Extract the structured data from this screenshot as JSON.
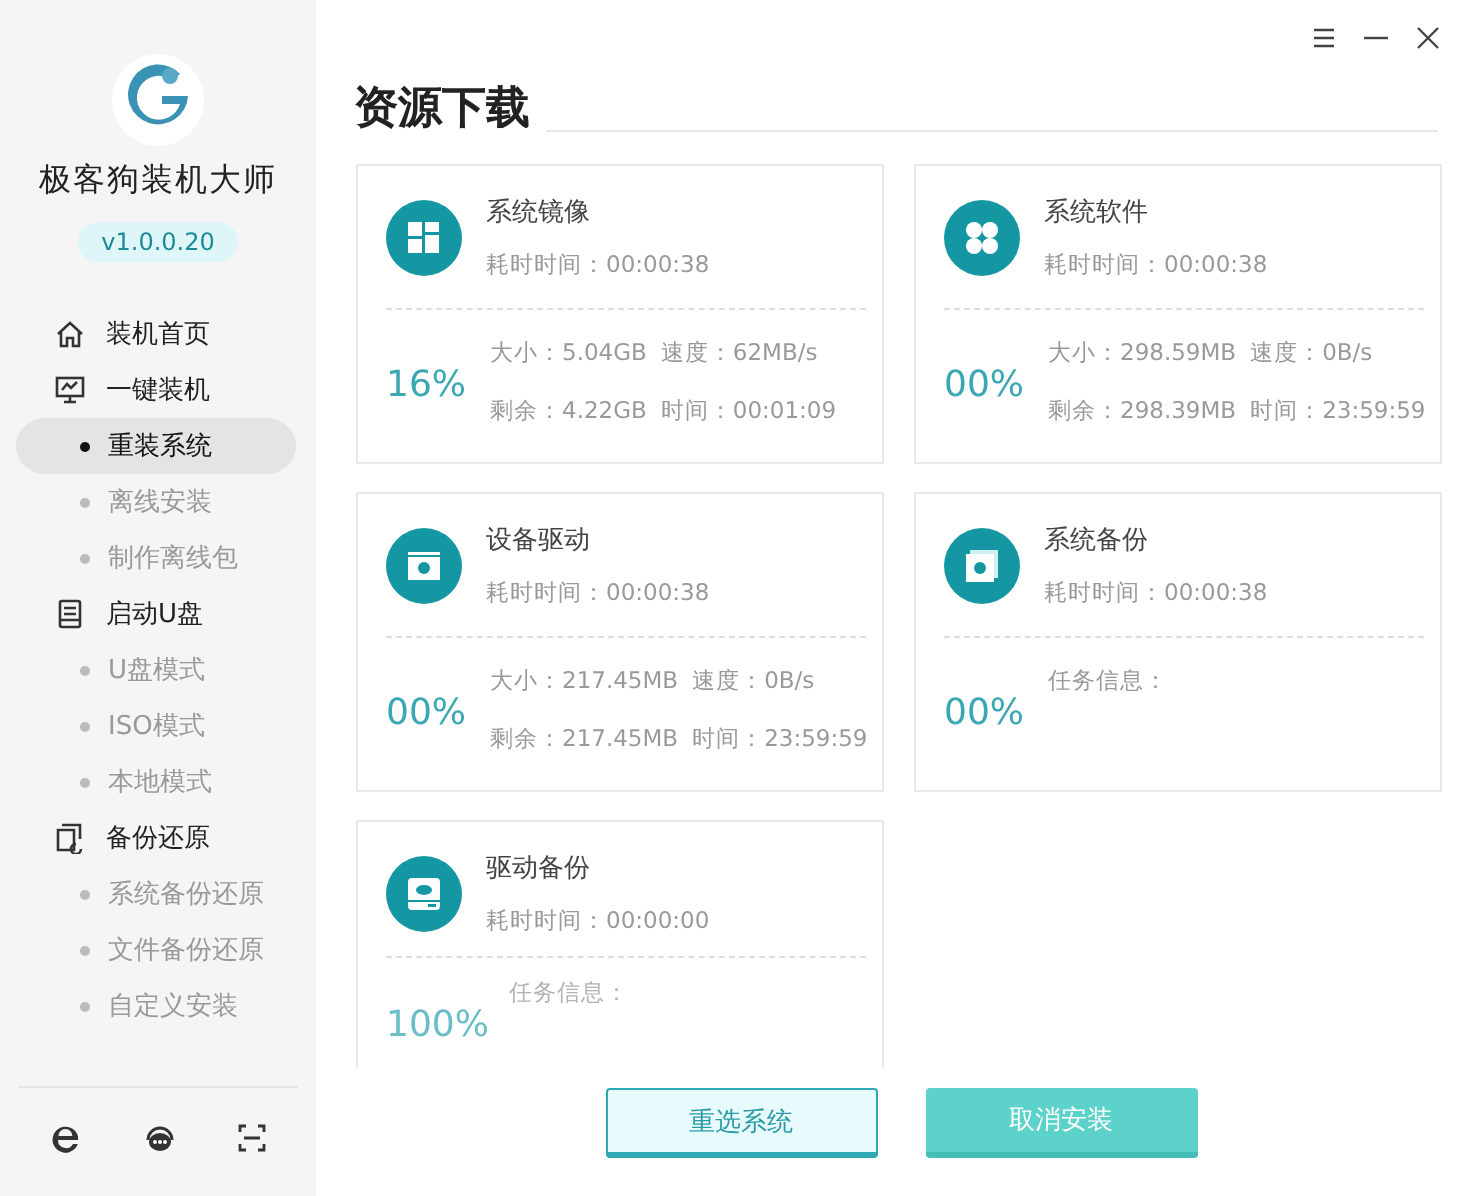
{
  "app": {
    "name": "极客狗装机大师",
    "version": "v1.0.0.20"
  },
  "sidebar": {
    "groups": [
      {
        "label": "装机首页"
      },
      {
        "label": "一键装机",
        "children": [
          {
            "label": "重装系统",
            "selected": true
          },
          {
            "label": "离线安装",
            "selected": false
          },
          {
            "label": "制作离线包",
            "selected": false
          }
        ]
      },
      {
        "label": "启动U盘",
        "children": [
          {
            "label": "U盘模式",
            "selected": false
          },
          {
            "label": "ISO模式",
            "selected": false
          },
          {
            "label": "本地模式",
            "selected": false
          }
        ]
      },
      {
        "label": "备份还原",
        "children": [
          {
            "label": "系统备份还原",
            "selected": false
          },
          {
            "label": "文件备份还原",
            "selected": false
          },
          {
            "label": "自定义安装",
            "selected": false
          }
        ]
      }
    ]
  },
  "page": {
    "title": "资源下载"
  },
  "cards": [
    {
      "kind": "stats",
      "title": "系统镜像",
      "elapsed": "耗时时间：00:00:38",
      "percent": "16%",
      "size": "大小：5.04GB",
      "speed": "速度：62MB/s",
      "remaining": "剩余：4.22GB",
      "time": "时间：00:01:09"
    },
    {
      "kind": "stats",
      "title": "系统软件",
      "elapsed": "耗时时间：00:00:38",
      "percent": "00%",
      "size": "大小：298.59MB",
      "speed": "速度：0B/s",
      "remaining": "剩余：298.39MB",
      "time": "时间：23:59:59"
    },
    {
      "kind": "stats",
      "title": "设备驱动",
      "elapsed": "耗时时间：00:00:38",
      "percent": "00%",
      "size": "大小：217.45MB",
      "speed": "速度：0B/s",
      "remaining": "剩余：217.45MB",
      "time": "时间：23:59:59"
    },
    {
      "kind": "info",
      "title": "系统备份",
      "elapsed": "耗时时间：00:00:38",
      "percent": "00%",
      "info": "任务信息："
    },
    {
      "kind": "info",
      "title": "驱动备份",
      "elapsed": "耗时时间：00:00:00",
      "percent": "100%",
      "info": "任务信息："
    }
  ],
  "buttons": [
    {
      "kind": "secondary",
      "label": "重选系统"
    },
    {
      "kind": "primary",
      "label": "取消安装"
    }
  ]
}
